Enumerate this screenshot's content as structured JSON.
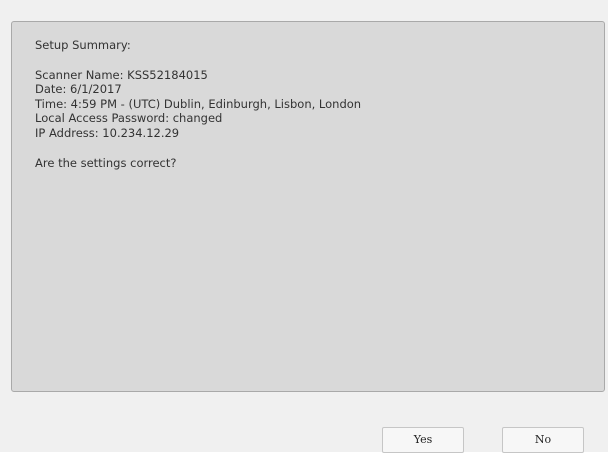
{
  "summary": {
    "heading": "Setup Summary:",
    "scanner_name": "Scanner Name: KSS52184015",
    "date": "Date: 6/1/2017",
    "time": "Time: 4:59 PM - (UTC) Dublin, Edinburgh, Lisbon, London",
    "password": "Local Access Password: changed",
    "ip_address": "IP Address: 10.234.12.29",
    "question": "Are the settings correct?"
  },
  "buttons": {
    "yes_label": "Yes",
    "no_label": "No"
  }
}
